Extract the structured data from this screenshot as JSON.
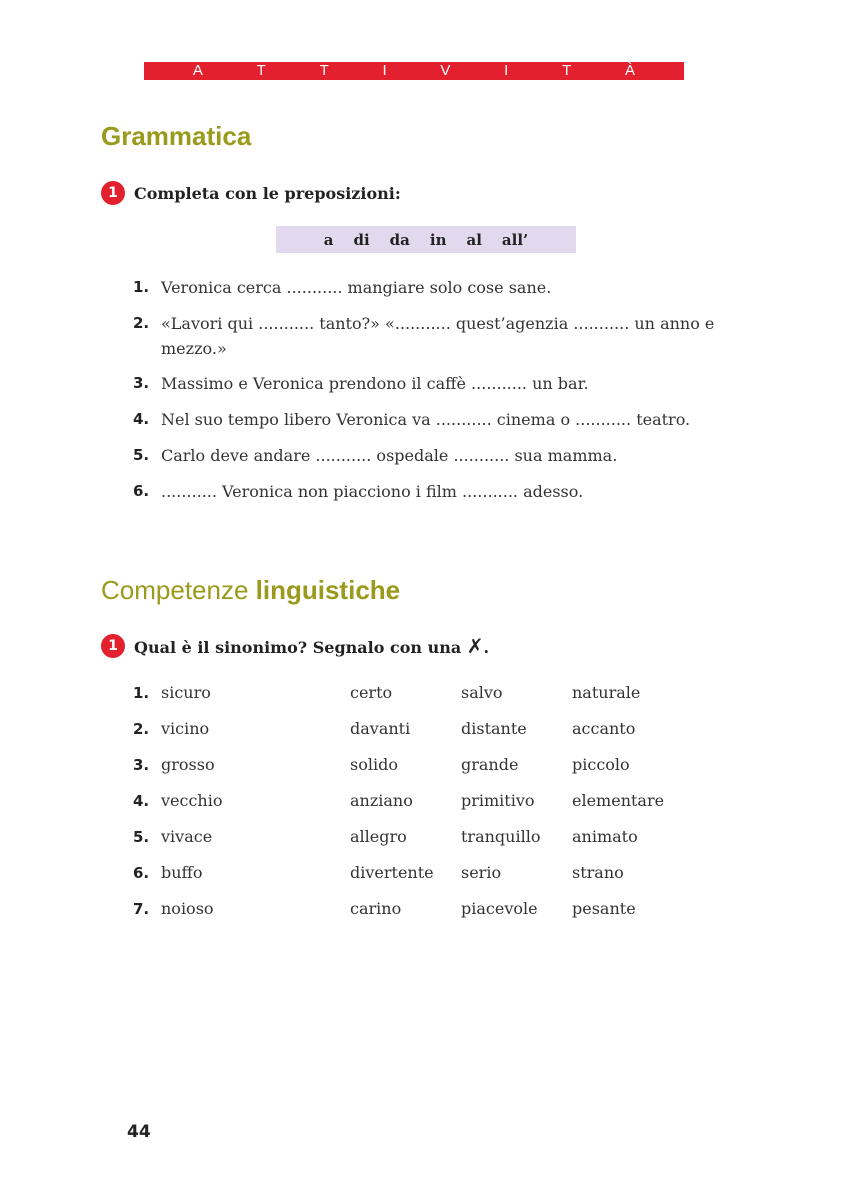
{
  "header": {
    "banner_letters": [
      "A",
      "T",
      "T",
      "I",
      "V",
      "I",
      "T",
      "À"
    ]
  },
  "grammatica": {
    "title": "Grammatica",
    "exercise": {
      "number": "1",
      "instruction": "Completa con le preposizioni:",
      "words": [
        "a",
        "di",
        "da",
        "in",
        "al",
        "all’"
      ],
      "items": [
        {
          "n": "1.",
          "text": "Veronica cerca ........... mangiare solo cose sane."
        },
        {
          "n": "2.",
          "text": "«Lavori qui ........... tanto?» «........... quest’agenzia ........... un anno e mezzo.»"
        },
        {
          "n": "3.",
          "text": "Massimo e Veronica prendono il caffè ........... un bar."
        },
        {
          "n": "4.",
          "text": "Nel suo tempo libero Veronica va ........... cinema o ........... teatro."
        },
        {
          "n": "5.",
          "text": "Carlo deve andare ........... ospedale ........... sua mamma."
        },
        {
          "n": "6.",
          "text": "........... Veronica non piacciono i film ........... adesso."
        }
      ]
    }
  },
  "competenze": {
    "title_light": "Competenze",
    "title_bold": "linguistiche",
    "exercise": {
      "number": "1",
      "instruction": "Qual è il sinonimo? Segnalo con una",
      "mark_symbol": "✗",
      "end_punct": ".",
      "rows": [
        {
          "n": "1.",
          "word": "sicuro",
          "options": [
            "certo",
            "salvo",
            "naturale"
          ]
        },
        {
          "n": "2.",
          "word": "vicino",
          "options": [
            "davanti",
            "distante",
            "accanto"
          ]
        },
        {
          "n": "3.",
          "word": "grosso",
          "options": [
            "solido",
            "grande",
            "piccolo"
          ]
        },
        {
          "n": "4.",
          "word": "vecchio",
          "options": [
            "anziano",
            "primitivo",
            "elementare"
          ]
        },
        {
          "n": "5.",
          "word": "vivace",
          "options": [
            "allegro",
            "tranquillo",
            "animato"
          ]
        },
        {
          "n": "6.",
          "word": "buffo",
          "options": [
            "divertente",
            "serio",
            "strano"
          ]
        },
        {
          "n": "7.",
          "word": "noioso",
          "options": [
            "carino",
            "piacevole",
            "pesante"
          ]
        }
      ]
    }
  },
  "footer": {
    "page_number": "44"
  },
  "colors": {
    "accent_red": "#e3202d",
    "title_olive": "#9a9a1c",
    "word_box_lavender": "#e2d9ee"
  }
}
